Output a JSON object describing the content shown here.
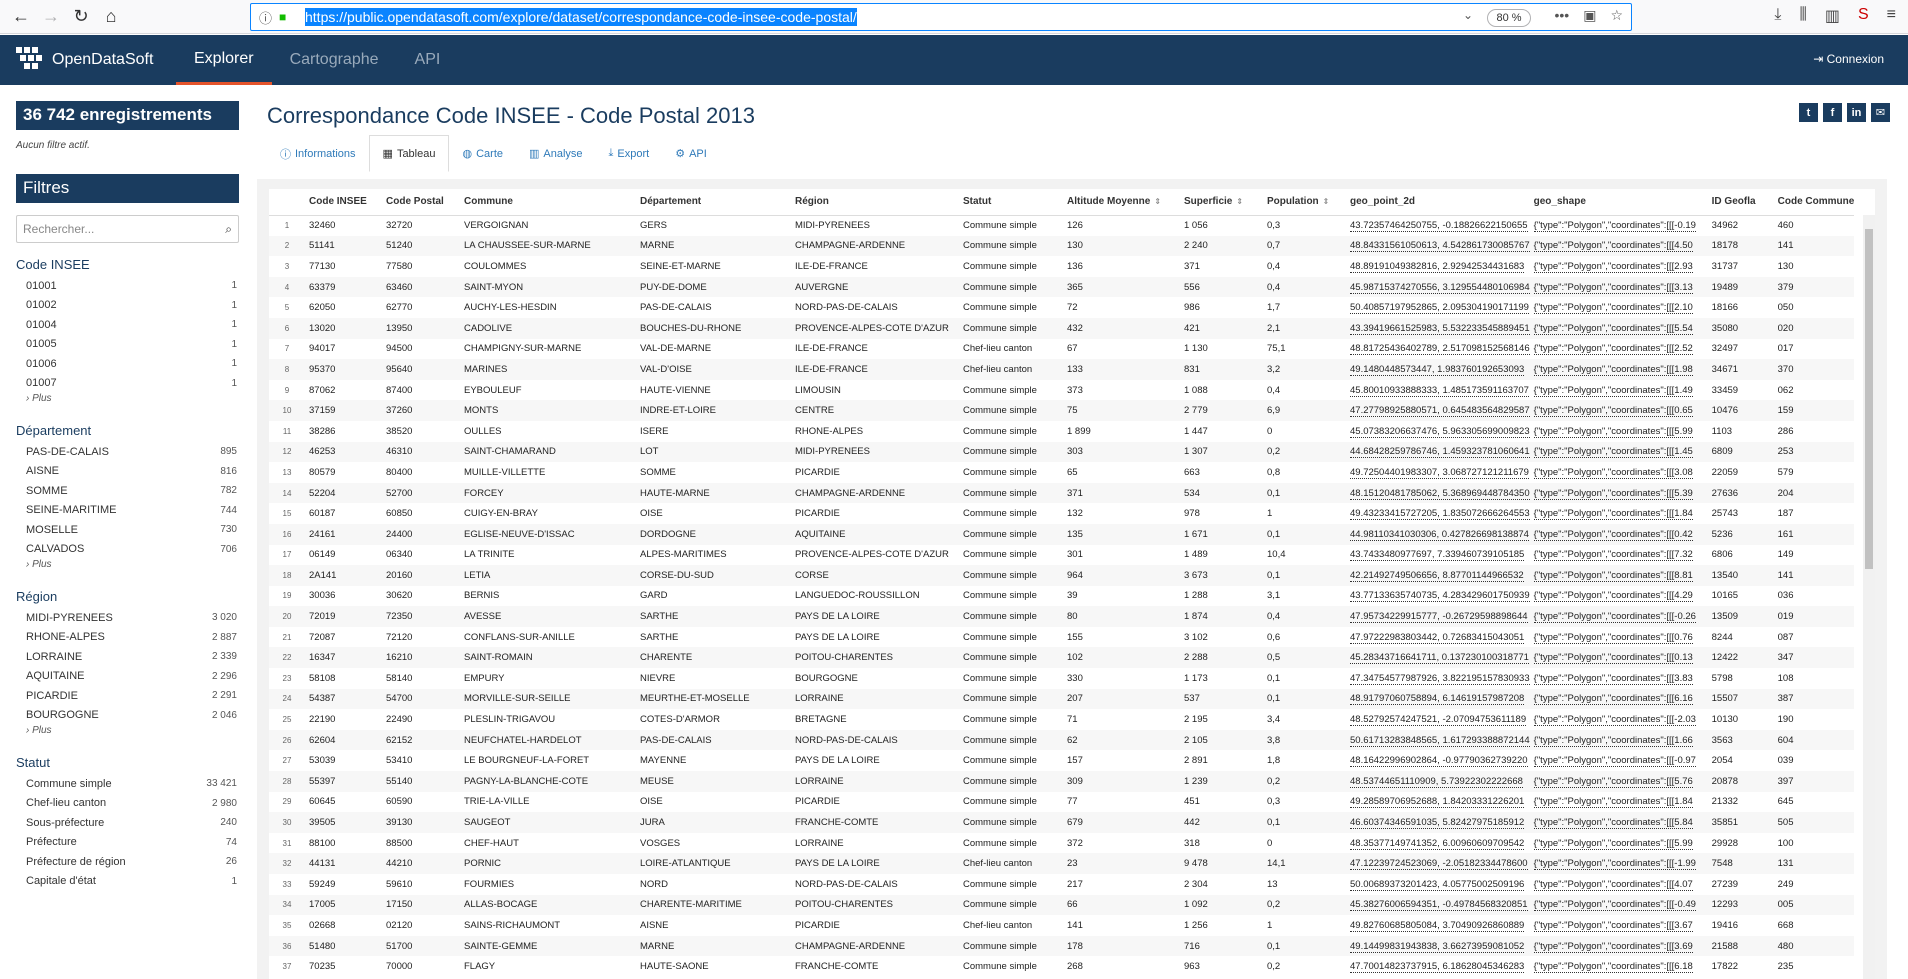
{
  "browser": {
    "url": "https://public.opendatasoft.com/explore/dataset/correspondance-code-insee-code-postal/",
    "zoom": "80 %"
  },
  "app": {
    "brand": "OpenDataSoft",
    "tabs": [
      "Explorer",
      "Cartographe",
      "API"
    ],
    "login": "Connexion"
  },
  "sidebar": {
    "count": "36 742 enregistrements",
    "nofilter": "Aucun filtre actif.",
    "filters_title": "Filtres",
    "search_placeholder": "Rechercher...",
    "more": "› Plus",
    "facets": [
      {
        "title": "Code INSEE",
        "items": [
          [
            "01001",
            "1"
          ],
          [
            "01002",
            "1"
          ],
          [
            "01004",
            "1"
          ],
          [
            "01005",
            "1"
          ],
          [
            "01006",
            "1"
          ],
          [
            "01007",
            "1"
          ]
        ],
        "more": true
      },
      {
        "title": "Département",
        "items": [
          [
            "PAS-DE-CALAIS",
            "895"
          ],
          [
            "AISNE",
            "816"
          ],
          [
            "SOMME",
            "782"
          ],
          [
            "SEINE-MARITIME",
            "744"
          ],
          [
            "MOSELLE",
            "730"
          ],
          [
            "CALVADOS",
            "706"
          ]
        ],
        "more": true
      },
      {
        "title": "Région",
        "items": [
          [
            "MIDI-PYRENEES",
            "3 020"
          ],
          [
            "RHONE-ALPES",
            "2 887"
          ],
          [
            "LORRAINE",
            "2 339"
          ],
          [
            "AQUITAINE",
            "2 296"
          ],
          [
            "PICARDIE",
            "2 291"
          ],
          [
            "BOURGOGNE",
            "2 046"
          ]
        ],
        "more": true
      },
      {
        "title": "Statut",
        "items": [
          [
            "Commune simple",
            "33 421"
          ],
          [
            "Chef-lieu canton",
            "2 980"
          ],
          [
            "Sous-préfecture",
            "240"
          ],
          [
            "Préfecture",
            "74"
          ],
          [
            "Préfecture de région",
            "26"
          ],
          [
            "Capitale d'état",
            "1"
          ]
        ],
        "more": false
      }
    ]
  },
  "main": {
    "title": "Correspondance Code INSEE - Code Postal 2013",
    "tabs": [
      "Informations",
      "Tableau",
      "Carte",
      "Analyse",
      "Export",
      "API"
    ],
    "columns": [
      "",
      "Code INSEE",
      "Code Postal",
      "Commune",
      "Département",
      "Région",
      "Statut",
      "Altitude Moyenne",
      "Superficie",
      "Population",
      "geo_point_2d",
      "geo_shape",
      "ID Geofla",
      "Code Commune"
    ],
    "rows": [
      [
        "1",
        "32460",
        "32720",
        "VERGOIGNAN",
        "GERS",
        "MIDI-PYRENEES",
        "Commune simple",
        "126",
        "1 056",
        "0,3",
        "43.72357464250755, -0.18826622150655",
        "{\"type\":\"Polygon\",\"coordinates\":[[[-0.19",
        "34962",
        "460"
      ],
      [
        "2",
        "51141",
        "51240",
        "LA CHAUSSEE-SUR-MARNE",
        "MARNE",
        "CHAMPAGNE-ARDENNE",
        "Commune simple",
        "130",
        "2 240",
        "0,7",
        "48.84331561050613, 4.542861730085767",
        "{\"type\":\"Polygon\",\"coordinates\":[[[4.50",
        "18178",
        "141"
      ],
      [
        "3",
        "77130",
        "77580",
        "COULOMMES",
        "SEINE-ET-MARNE",
        "ILE-DE-FRANCE",
        "Commune simple",
        "136",
        "371",
        "0,4",
        "48.89191049382816, 2.92942534431683",
        "{\"type\":\"Polygon\",\"coordinates\":[[[2.93",
        "31737",
        "130"
      ],
      [
        "4",
        "63379",
        "63460",
        "SAINT-MYON",
        "PUY-DE-DOME",
        "AUVERGNE",
        "Commune simple",
        "365",
        "556",
        "0,4",
        "45.98715374270556, 3.129554480106984",
        "{\"type\":\"Polygon\",\"coordinates\":[[[3.13",
        "19489",
        "379"
      ],
      [
        "5",
        "62050",
        "62770",
        "AUCHY-LES-HESDIN",
        "PAS-DE-CALAIS",
        "NORD-PAS-DE-CALAIS",
        "Commune simple",
        "72",
        "986",
        "1,7",
        "50.40857197952865, 2.095304190171199",
        "{\"type\":\"Polygon\",\"coordinates\":[[[2.10",
        "18166",
        "050"
      ],
      [
        "6",
        "13020",
        "13950",
        "CADOLIVE",
        "BOUCHES-DU-RHONE",
        "PROVENCE-ALPES-COTE D'AZUR",
        "Commune simple",
        "432",
        "421",
        "2,1",
        "43.39419661525983, 5.532233545889451",
        "{\"type\":\"Polygon\",\"coordinates\":[[[5.54",
        "35080",
        "020"
      ],
      [
        "7",
        "94017",
        "94500",
        "CHAMPIGNY-SUR-MARNE",
        "VAL-DE-MARNE",
        "ILE-DE-FRANCE",
        "Chef-lieu canton",
        "67",
        "1 130",
        "75,1",
        "48.81725436402789, 2.517098152568146",
        "{\"type\":\"Polygon\",\"coordinates\":[[[2.52",
        "32497",
        "017"
      ],
      [
        "8",
        "95370",
        "95640",
        "MARINES",
        "VAL-D'OISE",
        "ILE-DE-FRANCE",
        "Chef-lieu canton",
        "133",
        "831",
        "3,2",
        "49.1480448573447, 1.983760192653093",
        "{\"type\":\"Polygon\",\"coordinates\":[[[1.98",
        "34671",
        "370"
      ],
      [
        "9",
        "87062",
        "87400",
        "EYBOULEUF",
        "HAUTE-VIENNE",
        "LIMOUSIN",
        "Commune simple",
        "373",
        "1 088",
        "0,4",
        "45.80010933888333, 1.485173591163707",
        "{\"type\":\"Polygon\",\"coordinates\":[[[1.49",
        "33459",
        "062"
      ],
      [
        "10",
        "37159",
        "37260",
        "MONTS",
        "INDRE-ET-LOIRE",
        "CENTRE",
        "Commune simple",
        "75",
        "2 779",
        "6,9",
        "47.27798925880571, 0.645483564829587",
        "{\"type\":\"Polygon\",\"coordinates\":[[[0.65",
        "10476",
        "159"
      ],
      [
        "11",
        "38286",
        "38520",
        "OULLES",
        "ISERE",
        "RHONE-ALPES",
        "Commune simple",
        "1 899",
        "1 447",
        "0",
        "45.07383206637476, 5.963305699009823",
        "{\"type\":\"Polygon\",\"coordinates\":[[[5.99",
        "1103",
        "286"
      ],
      [
        "12",
        "46253",
        "46310",
        "SAINT-CHAMARAND",
        "LOT",
        "MIDI-PYRENEES",
        "Commune simple",
        "303",
        "1 307",
        "0,2",
        "44.68428259786746, 1.459323781060641",
        "{\"type\":\"Polygon\",\"coordinates\":[[[1.45",
        "6809",
        "253"
      ],
      [
        "13",
        "80579",
        "80400",
        "MUILLE-VILLETTE",
        "SOMME",
        "PICARDIE",
        "Commune simple",
        "65",
        "663",
        "0,8",
        "49.72504401983307, 3.068727121211679",
        "{\"type\":\"Polygon\",\"coordinates\":[[[3.08",
        "22059",
        "579"
      ],
      [
        "14",
        "52204",
        "52700",
        "FORCEY",
        "HAUTE-MARNE",
        "CHAMPAGNE-ARDENNE",
        "Commune simple",
        "371",
        "534",
        "0,1",
        "48.15120481785062, 5.368969448784350",
        "{\"type\":\"Polygon\",\"coordinates\":[[[5.39",
        "27636",
        "204"
      ],
      [
        "15",
        "60187",
        "60850",
        "CUIGY-EN-BRAY",
        "OISE",
        "PICARDIE",
        "Commune simple",
        "132",
        "978",
        "1",
        "49.43233415727205, 1.835072666264553",
        "{\"type\":\"Polygon\",\"coordinates\":[[[1.84",
        "25743",
        "187"
      ],
      [
        "16",
        "24161",
        "24400",
        "EGLISE-NEUVE-D'ISSAC",
        "DORDOGNE",
        "AQUITAINE",
        "Commune simple",
        "135",
        "1 671",
        "0,1",
        "44.98110341030306, 0.427826698138874",
        "{\"type\":\"Polygon\",\"coordinates\":[[[0.42",
        "5236",
        "161"
      ],
      [
        "17",
        "06149",
        "06340",
        "LA TRINITE",
        "ALPES-MARITIMES",
        "PROVENCE-ALPES-COTE D'AZUR",
        "Commune simple",
        "301",
        "1 489",
        "10,4",
        "43.7433480977697, 7.339460739105185",
        "{\"type\":\"Polygon\",\"coordinates\":[[[7.32",
        "6806",
        "149"
      ],
      [
        "18",
        "2A141",
        "20160",
        "LETIA",
        "CORSE-DU-SUD",
        "CORSE",
        "Commune simple",
        "964",
        "3 673",
        "0,1",
        "42.21492749506656, 8.87701144966532",
        "{\"type\":\"Polygon\",\"coordinates\":[[[8.81",
        "13540",
        "141"
      ],
      [
        "19",
        "30036",
        "30620",
        "BERNIS",
        "GARD",
        "LANGUEDOC-ROUSSILLON",
        "Commune simple",
        "39",
        "1 288",
        "3,1",
        "43.77133635740735, 4.283429601750939",
        "{\"type\":\"Polygon\",\"coordinates\":[[[4.29",
        "10165",
        "036"
      ],
      [
        "20",
        "72019",
        "72350",
        "AVESSE",
        "SARTHE",
        "PAYS DE LA LOIRE",
        "Commune simple",
        "80",
        "1 874",
        "0,4",
        "47.95734229915777, -0.26729598898644",
        "{\"type\":\"Polygon\",\"coordinates\":[[[-0.26",
        "13509",
        "019"
      ],
      [
        "21",
        "72087",
        "72120",
        "CONFLANS-SUR-ANILLE",
        "SARTHE",
        "PAYS DE LA LOIRE",
        "Commune simple",
        "155",
        "3 102",
        "0,6",
        "47.97222983803442, 0.72683415043051",
        "{\"type\":\"Polygon\",\"coordinates\":[[[0.76",
        "8244",
        "087"
      ],
      [
        "22",
        "16347",
        "16210",
        "SAINT-ROMAIN",
        "CHARENTE",
        "POITOU-CHARENTES",
        "Commune simple",
        "102",
        "2 288",
        "0,5",
        "45.28343716641711, 0.137230100318771",
        "{\"type\":\"Polygon\",\"coordinates\":[[[0.13",
        "12422",
        "347"
      ],
      [
        "23",
        "58108",
        "58140",
        "EMPURY",
        "NIEVRE",
        "BOURGOGNE",
        "Commune simple",
        "330",
        "1 173",
        "0,1",
        "47.34754577987926, 3.822195157830933",
        "{\"type\":\"Polygon\",\"coordinates\":[[[3.83",
        "5798",
        "108"
      ],
      [
        "24",
        "54387",
        "54700",
        "MORVILLE-SUR-SEILLE",
        "MEURTHE-ET-MOSELLE",
        "LORRAINE",
        "Commune simple",
        "207",
        "537",
        "0,1",
        "48.91797060758894, 6.14619157987208",
        "{\"type\":\"Polygon\",\"coordinates\":[[[6.16",
        "15507",
        "387"
      ],
      [
        "25",
        "22190",
        "22490",
        "PLESLIN-TRIGAVOU",
        "COTES-D'ARMOR",
        "BRETAGNE",
        "Commune simple",
        "71",
        "2 195",
        "3,4",
        "48.52792574247521, -2.07094753611189",
        "{\"type\":\"Polygon\",\"coordinates\":[[[-2.03",
        "10130",
        "190"
      ],
      [
        "26",
        "62604",
        "62152",
        "NEUFCHATEL-HARDELOT",
        "PAS-DE-CALAIS",
        "NORD-PAS-DE-CALAIS",
        "Commune simple",
        "62",
        "2 105",
        "3,8",
        "50.61713283848565, 1.617293388872144",
        "{\"type\":\"Polygon\",\"coordinates\":[[[1.66",
        "3563",
        "604"
      ],
      [
        "27",
        "53039",
        "53410",
        "LE BOURGNEUF-LA-FORET",
        "MAYENNE",
        "PAYS DE LA LOIRE",
        "Commune simple",
        "157",
        "2 891",
        "1,8",
        "48.16422996902864, -0.97790362739220",
        "{\"type\":\"Polygon\",\"coordinates\":[[[-0.97",
        "2054",
        "039"
      ],
      [
        "28",
        "55397",
        "55140",
        "PAGNY-LA-BLANCHE-COTE",
        "MEUSE",
        "LORRAINE",
        "Commune simple",
        "309",
        "1 239",
        "0,2",
        "48.53744651110909, 5.73922302222668",
        "{\"type\":\"Polygon\",\"coordinates\":[[[5.76",
        "20878",
        "397"
      ],
      [
        "29",
        "60645",
        "60590",
        "TRIE-LA-VILLE",
        "OISE",
        "PICARDIE",
        "Commune simple",
        "77",
        "451",
        "0,3",
        "49.28589706952688, 1.84203331226201",
        "{\"type\":\"Polygon\",\"coordinates\":[[[1.84",
        "21332",
        "645"
      ],
      [
        "30",
        "39505",
        "39130",
        "SAUGEOT",
        "JURA",
        "FRANCHE-COMTE",
        "Commune simple",
        "679",
        "442",
        "0,1",
        "46.60374346591035, 5.82427975185912",
        "{\"type\":\"Polygon\",\"coordinates\":[[[5.84",
        "35851",
        "505"
      ],
      [
        "31",
        "88100",
        "88500",
        "CHEF-HAUT",
        "VOSGES",
        "LORRAINE",
        "Commune simple",
        "372",
        "318",
        "0",
        "48.35377149741352, 6.00960609709542",
        "{\"type\":\"Polygon\",\"coordinates\":[[[5.99",
        "29928",
        "100"
      ],
      [
        "32",
        "44131",
        "44210",
        "PORNIC",
        "LOIRE-ATLANTIQUE",
        "PAYS DE LA LOIRE",
        "Chef-lieu canton",
        "23",
        "9 478",
        "14,1",
        "47.12239724523069, -2.05182334478600",
        "{\"type\":\"Polygon\",\"coordinates\":[[[-1.99",
        "7548",
        "131"
      ],
      [
        "33",
        "59249",
        "59610",
        "FOURMIES",
        "NORD",
        "NORD-PAS-DE-CALAIS",
        "Commune simple",
        "217",
        "2 304",
        "13",
        "50.00689373201423, 4.05775002509196",
        "{\"type\":\"Polygon\",\"coordinates\":[[[4.07",
        "27239",
        "249"
      ],
      [
        "34",
        "17005",
        "17150",
        "ALLAS-BOCAGE",
        "CHARENTE-MARITIME",
        "POITOU-CHARENTES",
        "Commune simple",
        "66",
        "1 092",
        "0,2",
        "45.38276006594351, -0.49784568320851",
        "{\"type\":\"Polygon\",\"coordinates\":[[[-0.49",
        "12293",
        "005"
      ],
      [
        "35",
        "02668",
        "02120",
        "SAINS-RICHAUMONT",
        "AISNE",
        "PICARDIE",
        "Chef-lieu canton",
        "141",
        "1 256",
        "1",
        "49.82760685805084, 3.70490926860889",
        "{\"type\":\"Polygon\",\"coordinates\":[[[3.67",
        "19416",
        "668"
      ],
      [
        "36",
        "51480",
        "51700",
        "SAINTE-GEMME",
        "MARNE",
        "CHAMPAGNE-ARDENNE",
        "Commune simple",
        "178",
        "716",
        "0,1",
        "49.14499831943838, 3.66273959081052",
        "{\"type\":\"Polygon\",\"coordinates\":[[[3.69",
        "21588",
        "480"
      ],
      [
        "37",
        "70235",
        "70000",
        "FLAGY",
        "HAUTE-SAONE",
        "FRANCHE-COMTE",
        "Commune simple",
        "268",
        "963",
        "0,2",
        "47.70014823737915, 6.18628045346283",
        "{\"type\":\"Polygon\",\"coordinates\":[[[6.18",
        "17822",
        "235"
      ]
    ]
  }
}
